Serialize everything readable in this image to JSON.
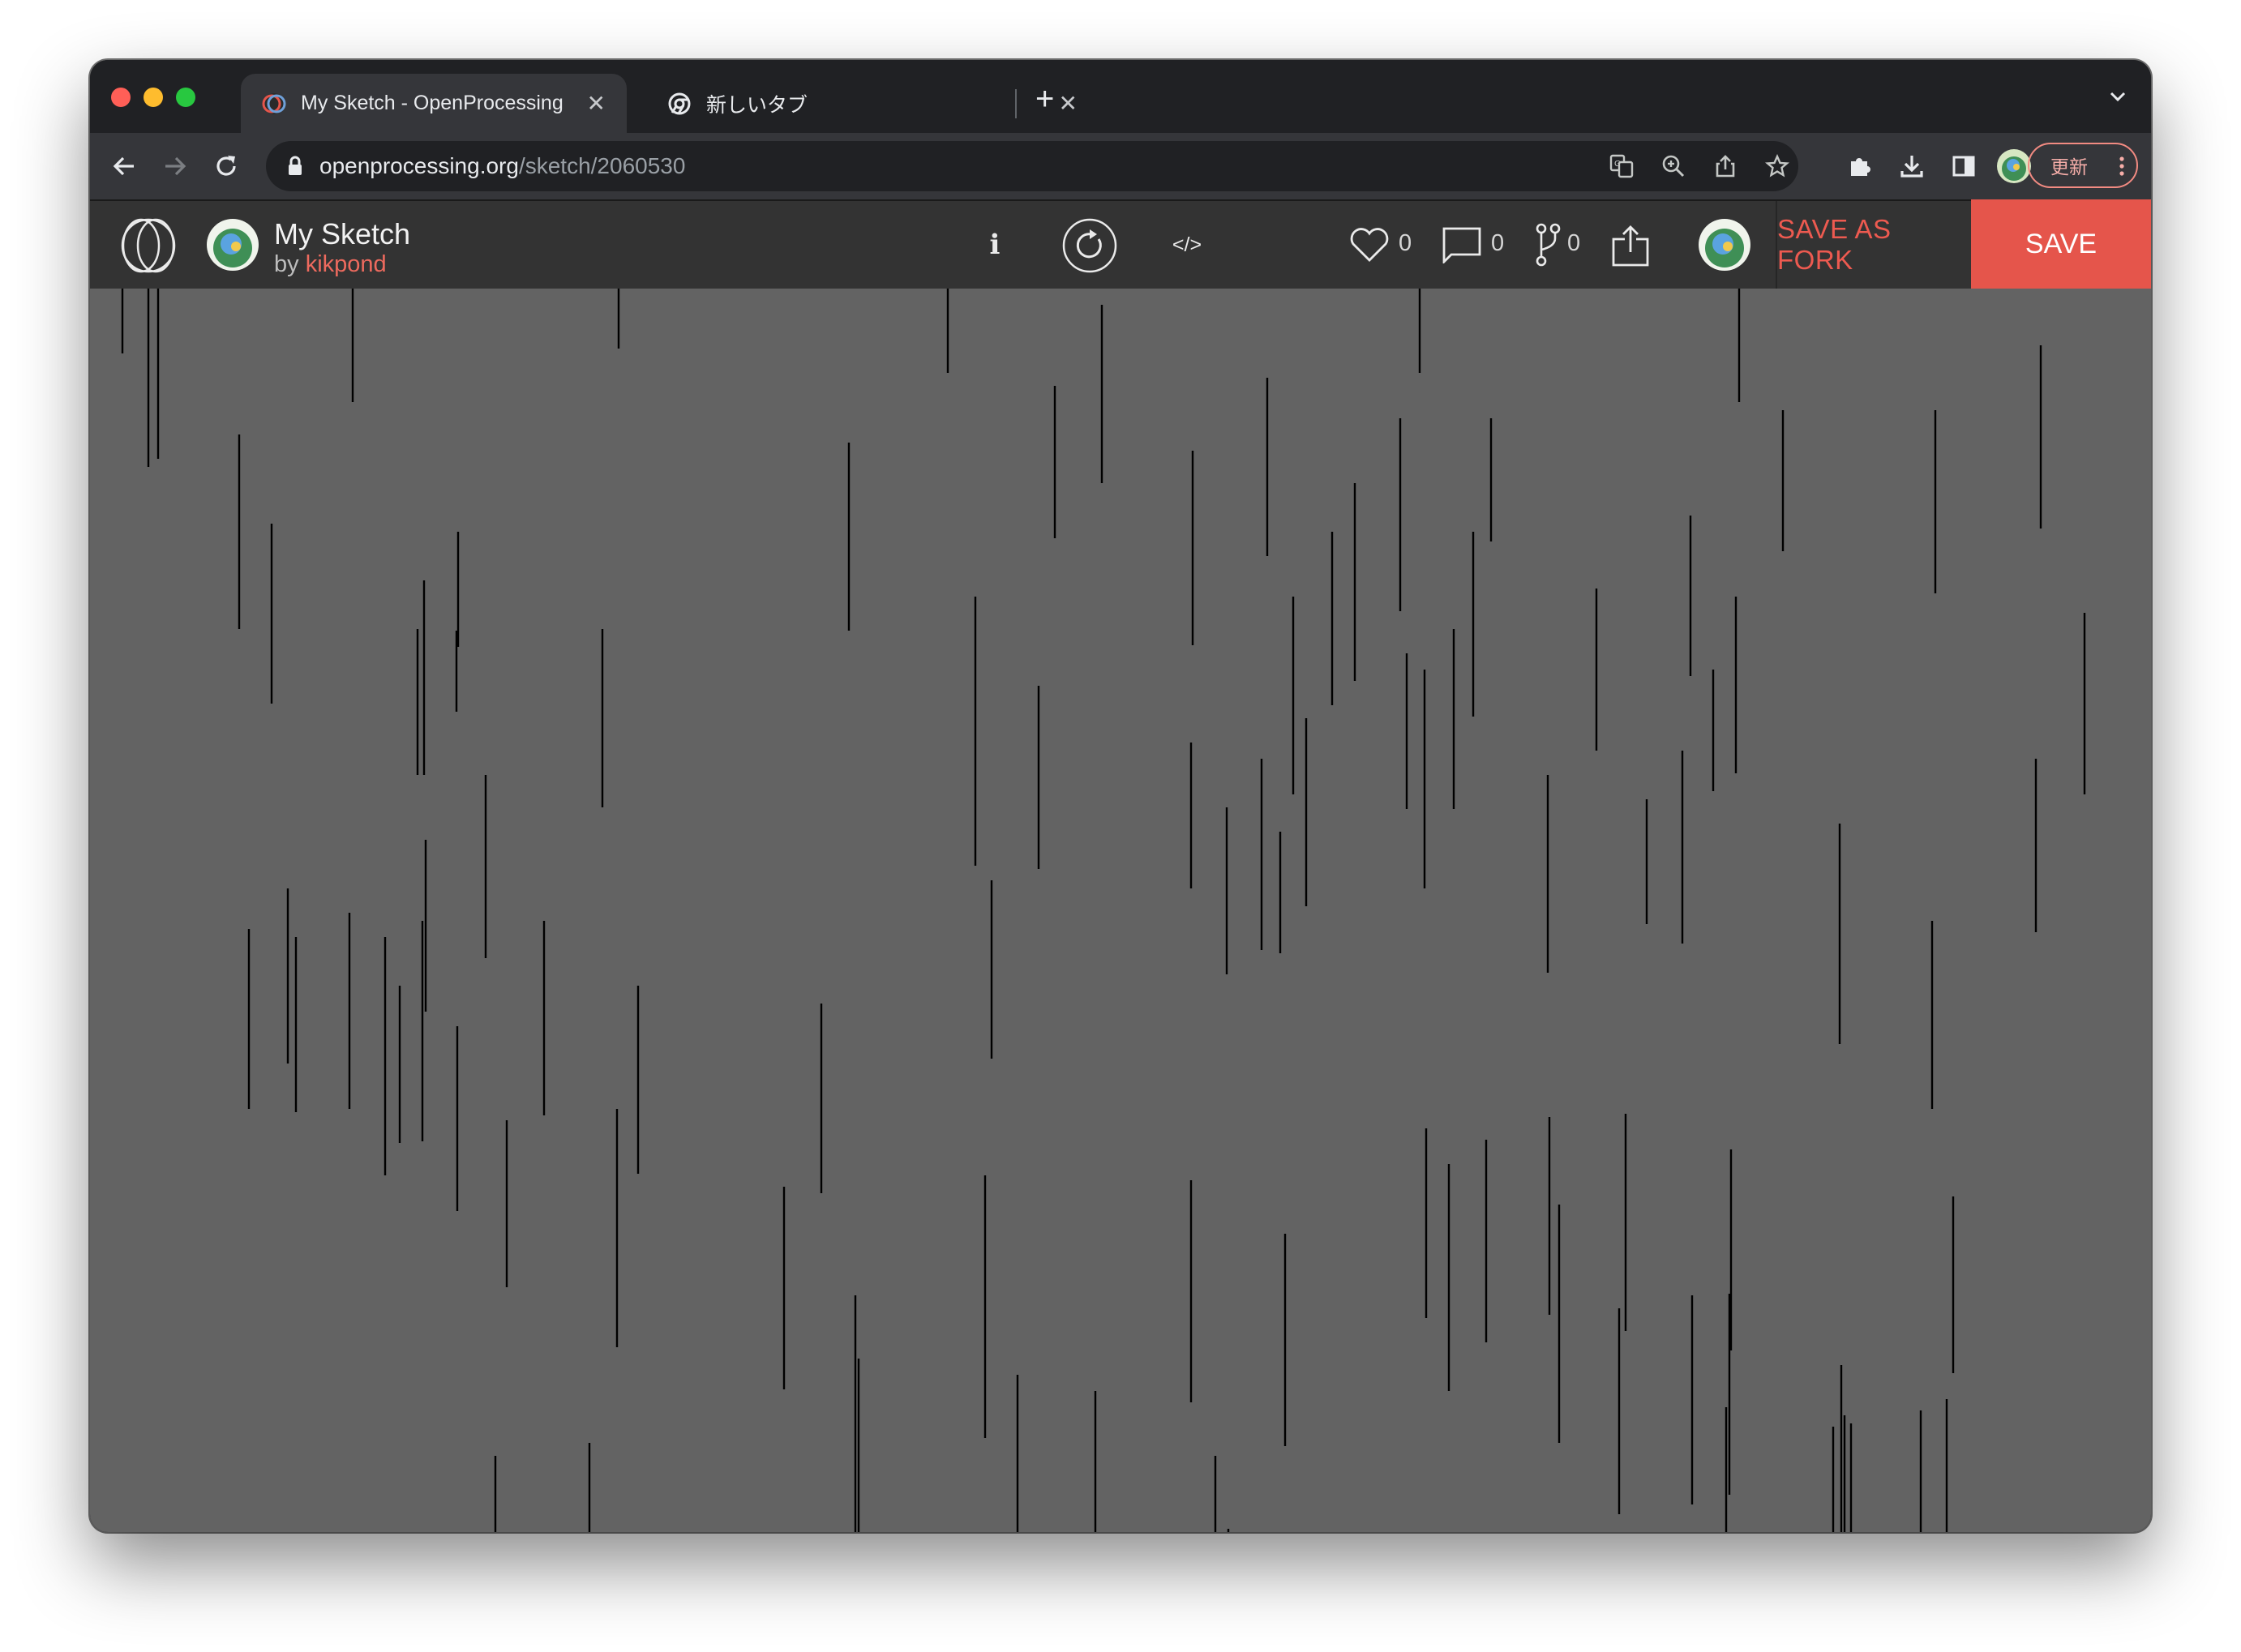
{
  "browser": {
    "tabs": [
      {
        "title": "My Sketch - OpenProcessing",
        "active": true
      },
      {
        "title": "新しいタブ",
        "active": false
      }
    ],
    "close_glyph": "✕",
    "new_tab_glyph": "+",
    "url_domain": "openprocessing.org",
    "url_path": "/sketch/2060530",
    "update_label": "更新"
  },
  "op": {
    "title": "My Sketch",
    "by_label": "by",
    "author": "kikpond",
    "info_glyph": "i",
    "code_glyph": "</>",
    "likes": "0",
    "comments": "0",
    "forks": "0",
    "save_as_fork_label": "SAVE AS FORK",
    "save_label": "SAVE"
  },
  "colors": {
    "accent": "#e5554b",
    "canvas_bg": "#636363",
    "stroke": "#000000"
  },
  "icons": [
    "back-arrow-icon",
    "forward-arrow-icon",
    "reload-icon",
    "lock-icon",
    "translate-icon",
    "zoom-icon",
    "share-icon",
    "star-icon",
    "extensions-icon",
    "download-icon",
    "sidepanel-icon",
    "profile-avatar",
    "kebab-menu-icon",
    "openprocessing-logo",
    "heart-icon",
    "comment-icon",
    "fork-icon",
    "restart-icon",
    "code-icon",
    "info-icon"
  ]
}
